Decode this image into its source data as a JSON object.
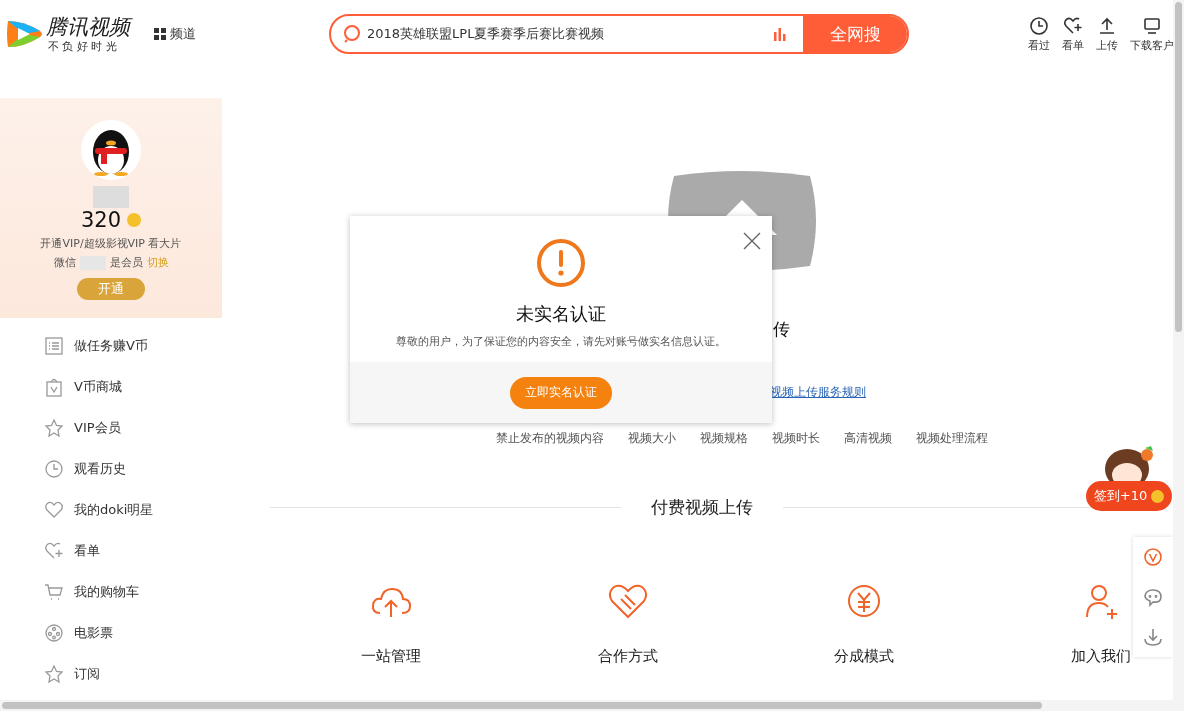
{
  "header": {
    "logo_title": "腾讯视频",
    "logo_slogan": "不 负 好 时 光",
    "channel_label": "频道",
    "search": {
      "value": "2018英雄联盟LPL夏季赛季后赛比赛视频",
      "button": "全网搜"
    },
    "tools": [
      {
        "kind": "history",
        "label": "看过"
      },
      {
        "kind": "watchlist",
        "label": "看单"
      },
      {
        "kind": "upload",
        "label": "上传"
      },
      {
        "kind": "client",
        "label": "下载客户"
      }
    ]
  },
  "profile": {
    "points": "320",
    "promo": "开通VIP/超级影视VIP 看大片",
    "account_prefix": "微信",
    "account_suffix": "是会员",
    "switch_link": "切换",
    "open_button": "开通"
  },
  "sidebar": {
    "items": [
      {
        "kind": "tasks",
        "label": "做任务赚V币"
      },
      {
        "kind": "shop",
        "label": "V币商城"
      },
      {
        "kind": "vip",
        "label": "VIP会员"
      },
      {
        "kind": "history",
        "label": "观看历史"
      },
      {
        "kind": "heart",
        "label": "我的doki明星"
      },
      {
        "kind": "watchlist",
        "label": "看单"
      },
      {
        "kind": "cart",
        "label": "我的购物车"
      },
      {
        "kind": "ticket",
        "label": "电影票"
      },
      {
        "kind": "star",
        "label": "订阅"
      }
    ]
  },
  "main": {
    "heading_fragment": "传",
    "rules_link": "视频上传服务规则",
    "tags": [
      "禁止发布的视频内容",
      "视频大小",
      "视频规格",
      "视频时长",
      "高清视频",
      "视频处理流程"
    ],
    "paid_heading": "付费视频上传",
    "features": [
      {
        "kind": "cloud",
        "label": "一站管理"
      },
      {
        "kind": "handshake",
        "label": "合作方式"
      },
      {
        "kind": "yuan",
        "label": "分成模式"
      },
      {
        "kind": "person",
        "label": "加入我们"
      }
    ]
  },
  "checkin": {
    "label": "签到+10"
  },
  "float_tools": [
    {
      "kind": "vip"
    },
    {
      "kind": "chat"
    },
    {
      "kind": "download"
    }
  ],
  "modal": {
    "title": "未实名认证",
    "message": "尊敬的用户，为了保证您的内容安全，请先对账号做实名信息认证。",
    "button": "立即实名认证"
  }
}
